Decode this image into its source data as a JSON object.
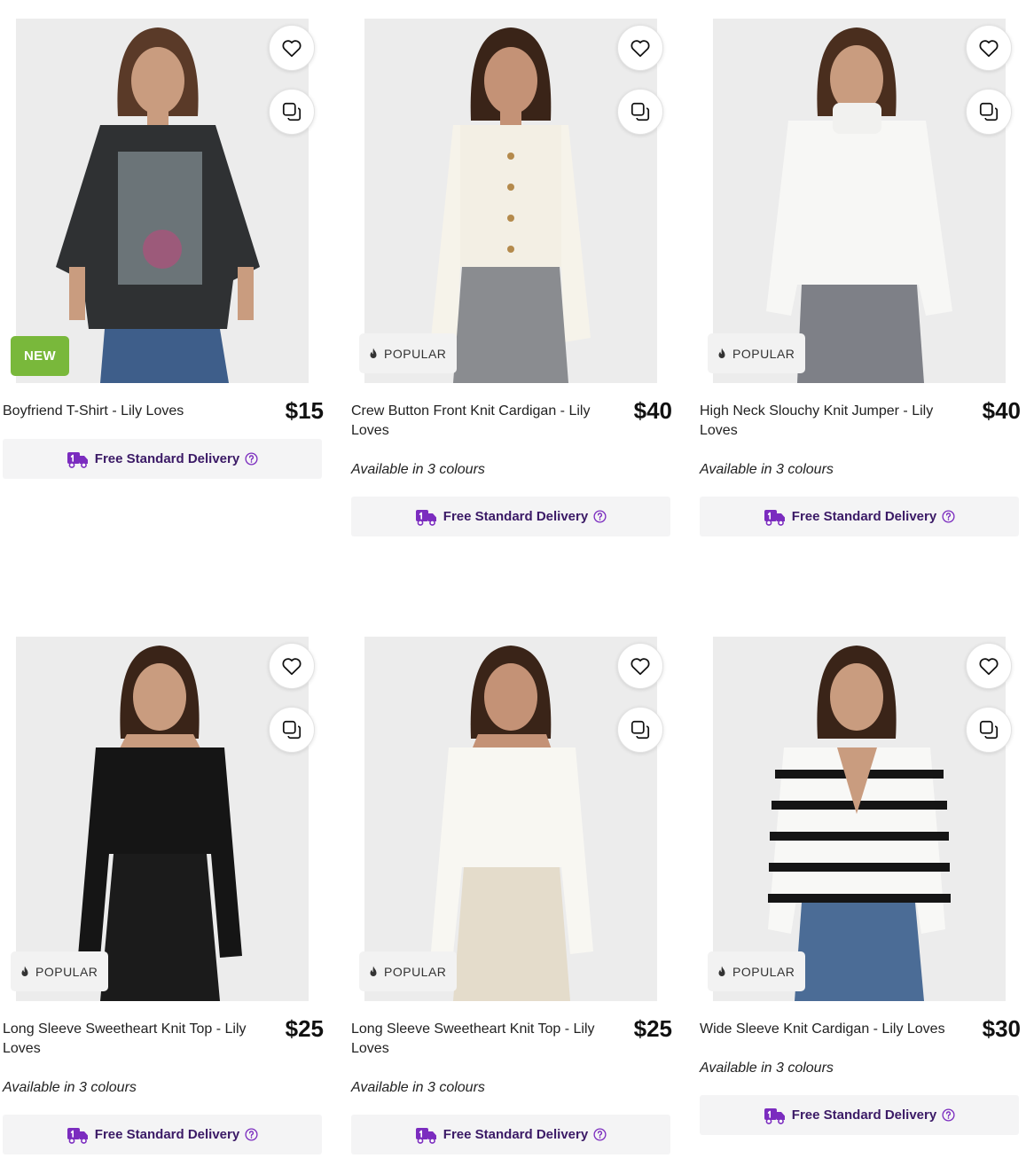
{
  "products": [
    {
      "title": "Boyfriend T-Shirt - Lily Loves",
      "price": "$15",
      "badge": "NEW",
      "colours_text": "",
      "delivery_label": "Free Standard Delivery"
    },
    {
      "title": "Crew Button Front Knit Cardigan - Lily Loves",
      "price": "$40",
      "badge": "POPULAR",
      "colours_text": "Available in 3 colours",
      "delivery_label": "Free Standard Delivery"
    },
    {
      "title": "High Neck Slouchy Knit Jumper - Lily Loves",
      "price": "$40",
      "badge": "POPULAR",
      "colours_text": "Available in 3 colours",
      "delivery_label": "Free Standard Delivery"
    },
    {
      "title": "Long Sleeve Sweetheart Knit Top - Lily Loves",
      "price": "$25",
      "badge": "POPULAR",
      "colours_text": "Available in 3 colours",
      "delivery_label": "Free Standard Delivery"
    },
    {
      "title": "Long Sleeve Sweetheart Knit Top - Lily Loves",
      "price": "$25",
      "badge": "POPULAR",
      "colours_text": "Available in 3 colours",
      "delivery_label": "Free Standard Delivery"
    },
    {
      "title": "Wide Sleeve Knit Cardigan - Lily Loves",
      "price": "$30",
      "badge": "POPULAR",
      "colours_text": "Available in 3 colours",
      "delivery_label": "Free Standard Delivery"
    }
  ],
  "icons": {
    "favourite": "heart-icon",
    "compare": "compare-icon",
    "popular": "flame-icon",
    "delivery": "delivery-truck-icon",
    "help": "question-circle-icon"
  },
  "colors": {
    "badge_new": "#79b83b",
    "delivery_text": "#3b1a66",
    "delivery_icon": "#7b2cbf",
    "delivery_bg": "#f4f4f5"
  }
}
